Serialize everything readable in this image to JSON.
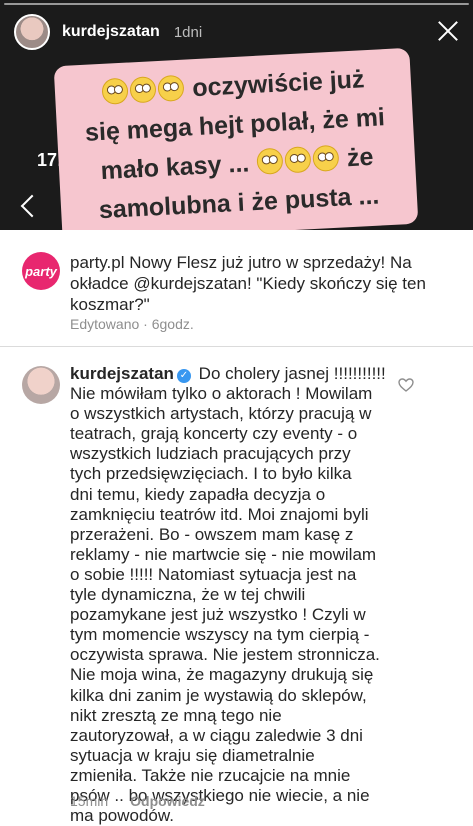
{
  "story": {
    "username": "kurdejszatan",
    "time": "1dni",
    "behind_time": "17:",
    "caption_line1": "oczywiście już",
    "caption_line2": "się mega hejt polał, że mi",
    "caption_line3": "mało kasy ...",
    "caption_line3b": "że",
    "caption_line4": "samolubna i że pusta ..."
  },
  "post": {
    "logo_text": "party",
    "author": "party.pl",
    "text_a": " Nowy Flesz już jutro w sprzedaży! Na okładce ",
    "mention": "@kurdejszatan",
    "text_b": "! \"Kiedy skończy się ten koszmar?\"",
    "meta": "Edytowano · 6godz."
  },
  "reply": {
    "author": "kurdejszatan",
    "verified_glyph": "✓",
    "body": " Do cholery jasnej !!!!!!!!!!!\nNie mówiłam tylko o aktorach ! Mowilam\no wszystkich artystach, którzy pracują w\nteatrach, grają koncerty czy eventy - o\nwszystkich ludziach pracujących przy\ntych przedsięwzięciach. I to było kilka\ndni temu, kiedy zapadła decyzja o\nzamknięciu teatrów itd. Moi znajomi byli\nprzerażeni. Bo - owszem mam kasę z\nreklamy - nie martwcie się - nie mowilam\no sobie !!!!! Natomiast sytuacja jest na\ntyle dynamiczna, że w tej chwili\npozamykane jest już wszystko ! Czyli w\ntym momencie wszyscy na tym cierpią -\noczywista sprawa. Nie jestem stronnicza.\nNie moja wina, że magazyny drukują się\nkilka dni zanim je wystawią do sklepów,\nnikt zresztą ze mną tego nie\nzautoryzował, a w ciągu zaledwie 3 dni\nsytuacja w kraju się diametralnie\nzmieniła. Także nie rzucajcie na mnie\npsów .. bo wszystkiego nie wiecie, a nie\nma powodów.",
    "time": "15min",
    "reply_label": "Odpowiedz"
  }
}
